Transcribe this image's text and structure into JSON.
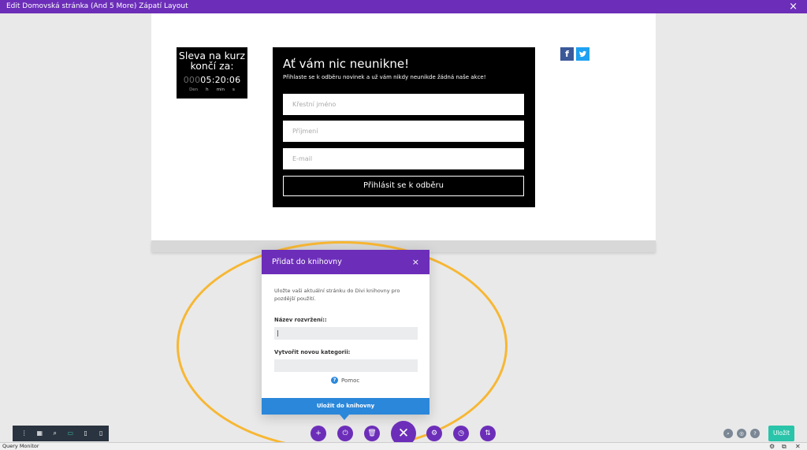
{
  "topbar": {
    "title": "Edit Domovská stránka (And 5 More) Zápatí Layout",
    "close_icon": "×"
  },
  "countdown": {
    "title": "Sleva na kurz končí za:",
    "days": "000",
    "time": "05:20:06",
    "units": [
      "Den",
      "h",
      "min",
      "s"
    ]
  },
  "optin": {
    "heading": "Ať vám nic neunikne!",
    "subtext": "Přihlaste se k odběru novinek a už vám nikdy neunikde žádná naše akce!",
    "first_name_placeholder": "Křestní jméno",
    "last_name_placeholder": "Příjmení",
    "email_placeholder": "E-mail",
    "subscribe_label": "Přihlásit se k odběru"
  },
  "social": {
    "facebook": "f",
    "twitter": "🐦"
  },
  "modal": {
    "title": "Přidat do knihovny",
    "close": "×",
    "description": "Uložte vaši aktuální stránku do Divi knihovny pro pozdější použití.",
    "layout_name_label": "Název rozvržení::",
    "layout_name_value": "",
    "category_label": "Vytvořit novou kategorii:",
    "category_value": "",
    "help_label": "Pomoc",
    "save_label": "Uložit do knihovny"
  },
  "view_toolbar": {
    "icons": [
      "more-icon",
      "wireframe-icon",
      "zoom-icon",
      "desktop-icon",
      "tablet-icon",
      "phone-icon"
    ],
    "glyphs": [
      "⋮",
      "▦",
      "⌕",
      "▭",
      "▯",
      "▯"
    ],
    "active": "desktop-icon"
  },
  "center_toolbar": {
    "glyphs": [
      "+",
      "⏻",
      "🗑",
      "✕",
      "⚙",
      "◷",
      "⇅"
    ],
    "icons": [
      "add-icon",
      "portability-icon",
      "trash-icon",
      "close-icon",
      "settings-icon",
      "history-icon",
      "sort-icon"
    ]
  },
  "right_toolbar": {
    "glyphs": [
      "⌕",
      "◎",
      "?"
    ],
    "icons": [
      "search-icon",
      "settings-circle-icon",
      "help-icon"
    ],
    "save_label": "Uložit"
  },
  "query_monitor": {
    "label": "Query Monitor"
  },
  "colors": {
    "purple": "#6c2eb9",
    "blue": "#2b87da",
    "teal": "#29c4a9",
    "highlight": "#f7b733"
  }
}
